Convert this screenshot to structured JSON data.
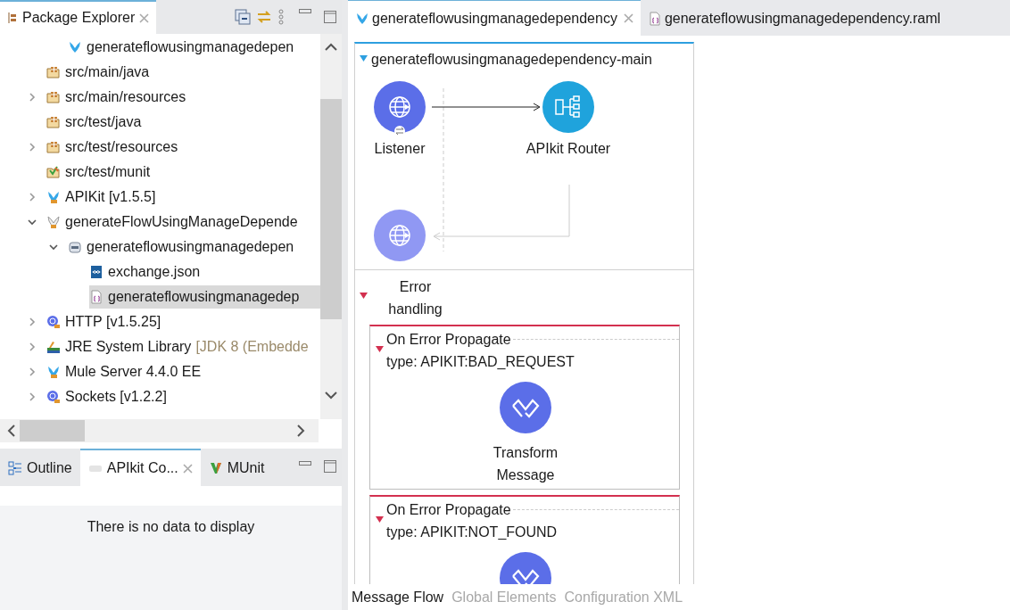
{
  "package_explorer": {
    "tabs": [
      {
        "label": "Package Explorer",
        "selected": true
      }
    ],
    "tree": [
      {
        "children": [
          {
            "label": "generateflowusingmanagedepen",
            "kind": "mule",
            "selected": false
          }
        ]
      },
      {
        "label": "src/main/java",
        "kind": "package-folder",
        "selected": false
      },
      {
        "label": "src/main/resources",
        "kind": "package-folder",
        "selected": false,
        "expanded": false
      },
      {
        "label": "src/test/java",
        "kind": "package-folder",
        "selected": false
      },
      {
        "label": "src/test/resources",
        "kind": "package-folder",
        "selected": false,
        "expanded": false
      },
      {
        "label": "src/test/munit",
        "kind": "munit-folder",
        "selected": false
      },
      {
        "label": "APIKit [v1.5.5]",
        "kind": "library",
        "selected": false,
        "expanded": false
      },
      {
        "label": "generateFlowUsingManageDepende",
        "kind": "project",
        "selected": false,
        "expanded": true,
        "children": [
          {
            "label": "generateflowusingmanagedepen",
            "kind": "jar",
            "selected": false,
            "expanded": true,
            "children": [
              {
                "label": "exchange.json",
                "kind": "json-file",
                "selected": false
              },
              {
                "label": "generateflowusingmanagedep",
                "kind": "raml-file",
                "selected": true
              }
            ]
          }
        ]
      },
      {
        "label": "HTTP [v1.5.25]",
        "kind": "connector",
        "selected": false,
        "expanded": false
      },
      {
        "label": "JRE System Library",
        "suffix": "[JDK 8 (Embedde",
        "kind": "jre",
        "selected": false,
        "expanded": false
      },
      {
        "label": "Mule Server 4.4.0 EE",
        "kind": "library",
        "selected": false,
        "expanded": false
      },
      {
        "label": "Sockets [v1.2.2]",
        "kind": "connector",
        "selected": false,
        "expanded": false
      }
    ]
  },
  "lower_panel": {
    "tabs": [
      {
        "label": "Outline",
        "kind": "outline",
        "selected": false
      },
      {
        "label": "APIkit Co...",
        "kind": "api",
        "selected": true
      },
      {
        "label": "MUnit",
        "kind": "munit",
        "selected": false
      }
    ],
    "message": "There is no data to display"
  },
  "editor": {
    "tabs": [
      {
        "label": "generateflowusingmanagedependency",
        "kind": "mule",
        "selected": true
      },
      {
        "label": "generateflowusingmanagedependency.raml",
        "kind": "raml-file",
        "selected": false
      }
    ],
    "flow": {
      "name": "generateflowusingmanagedependency-main",
      "expanded": true,
      "nodes": [
        {
          "label": "Listener",
          "kind": "listener"
        },
        {
          "label": "APIkit Router",
          "kind": "router"
        },
        {
          "kind": "response"
        }
      ],
      "error_handling": {
        "label": "Error handling",
        "expanded": true,
        "handlers": [
          {
            "title": "On Error Propagate",
            "type": "type: APIKIT:BAD_REQUEST",
            "expanded": true,
            "processor": {
              "label": "Transform Message",
              "kind": "transform"
            }
          },
          {
            "title": "On Error Propagate",
            "type": "type: APIKIT:NOT_FOUND",
            "expanded": true,
            "processor": {
              "kind": "transform"
            }
          }
        ]
      }
    },
    "bottom_tabs": [
      {
        "label": "Message Flow",
        "selected": true
      },
      {
        "label": "Global Elements",
        "selected": false
      },
      {
        "label": "Configuration XML",
        "selected": false
      }
    ]
  }
}
